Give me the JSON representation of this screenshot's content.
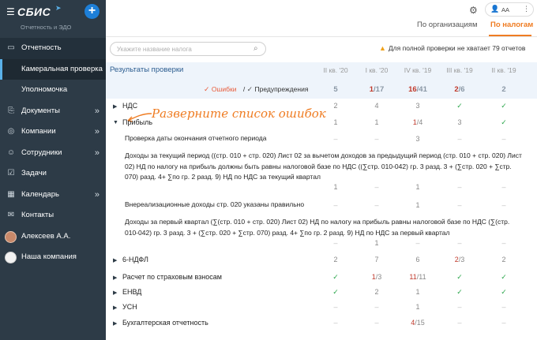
{
  "app": {
    "logo": "СБИС",
    "subtitle": "Отчетность и ЭДО"
  },
  "sidebar": {
    "items": [
      {
        "label": "Отчетность",
        "icon": "report-icon",
        "chev": ""
      },
      {
        "label": "Камеральная проверка",
        "icon": "",
        "chev": ""
      },
      {
        "label": "Уполномочка",
        "icon": "",
        "chev": ""
      },
      {
        "label": "Документы",
        "icon": "document-icon",
        "chev": "»"
      },
      {
        "label": "Компании",
        "icon": "company-icon",
        "chev": "»"
      },
      {
        "label": "Сотрудники",
        "icon": "people-icon",
        "chev": "»"
      },
      {
        "label": "Задачи",
        "icon": "task-icon",
        "chev": ""
      },
      {
        "label": "Календарь",
        "icon": "calendar-icon",
        "chev": "»"
      },
      {
        "label": "Контакты",
        "icon": "chat-icon",
        "chev": ""
      },
      {
        "label": "Алексеев А.А.",
        "icon": "",
        "chev": ""
      },
      {
        "label": "Наша компания",
        "icon": "",
        "chev": ""
      }
    ]
  },
  "topbar": {
    "user_initials": "АА"
  },
  "tabs": {
    "by_org": "По организациям",
    "by_tax": "По налогам"
  },
  "search": {
    "placeholder": "Укажите название налога"
  },
  "warning": "Для полной проверки не хватает 79 отчетов",
  "results": {
    "title": "Результаты проверки",
    "columns": [
      "II кв. '20",
      "I кв. '20",
      "IV кв. '19",
      "III кв. '19",
      "II кв. '19"
    ],
    "legend_errors": "Ошибки",
    "legend_sep": "/",
    "legend_warnings": "Предупреждения",
    "summary": [
      {
        "a": "5",
        "b": ""
      },
      {
        "a": "1",
        "b": "/17"
      },
      {
        "a": "16",
        "b": "/41"
      },
      {
        "a": "2",
        "b": "/6"
      },
      {
        "a": "2",
        "b": ""
      }
    ]
  },
  "callout": "Разверните список ошибок",
  "rows": {
    "nds": {
      "label": "НДС",
      "cells": [
        "2",
        "4",
        "3",
        "✓",
        "✓"
      ]
    },
    "profit": {
      "label": "Прибыль",
      "cells": [
        "1",
        "1",
        "1|/4",
        "3",
        "✓"
      ]
    },
    "d1": {
      "label": "Проверка даты окончания отчетного периода",
      "cells": [
        "–",
        "–",
        "3",
        "–",
        "–"
      ]
    },
    "d2": {
      "label": "Доходы за текущий период ((стр. 010 + стр. 020) Лист 02 за вычетом доходов за предыдущий период (стр. 010 + стр. 020) Лист 02) НД по налогу на прибыль должны быть равны налоговой базе по НДС ((∑стр. 010-042) гр. 3 разд. 3 + (∑стр. 020 + ∑стр. 070) разд. 4+ ∑по гр. 2 разд. 9) НД по НДС за текущий квартал",
      "cells": [
        "1",
        "–",
        "1",
        "–",
        "–"
      ]
    },
    "d3": {
      "label": "Внереализационные доходы стр. 020 указаны правильно",
      "cells": [
        "–",
        "–",
        "1",
        "–",
        "–"
      ]
    },
    "d4": {
      "label": "Доходы за первый квартал (∑(стр. 010 + стр. 020) Лист 02) НД по налогу на прибыль равны налоговой базе по НДС (∑(стр. 010-042) гр. 3 разд. 3 + (∑стр. 020 + ∑стр. 070) разд. 4+ ∑по гр. 2 разд. 9) НД по НДС за первый квартал",
      "cells": [
        "–",
        "1",
        "–",
        "–",
        "–"
      ]
    },
    "ndfl": {
      "label": "6-НДФЛ",
      "cells": [
        "2",
        "7",
        "6",
        "2|/3",
        "2"
      ]
    },
    "insurance": {
      "label": "Расчет по страховым взносам",
      "cells": [
        "✓",
        "1|/3",
        "11|/11",
        "✓",
        "✓"
      ]
    },
    "envd": {
      "label": "ЕНВД",
      "cells": [
        "✓",
        "2",
        "1",
        "✓",
        "✓"
      ]
    },
    "usn": {
      "label": "УСН",
      "cells": [
        "–",
        "–",
        "1",
        "–",
        "–"
      ]
    },
    "accounting": {
      "label": "Бухгалтерская отчетность",
      "cells": [
        "–",
        "–",
        "4|/15",
        "–",
        "–"
      ]
    }
  },
  "colors": {
    "accent": "#ef7c22",
    "sidebar": "#2d3b47",
    "error": "#c0392b",
    "ok": "#2aa64a",
    "link": "#2b5c8f"
  }
}
